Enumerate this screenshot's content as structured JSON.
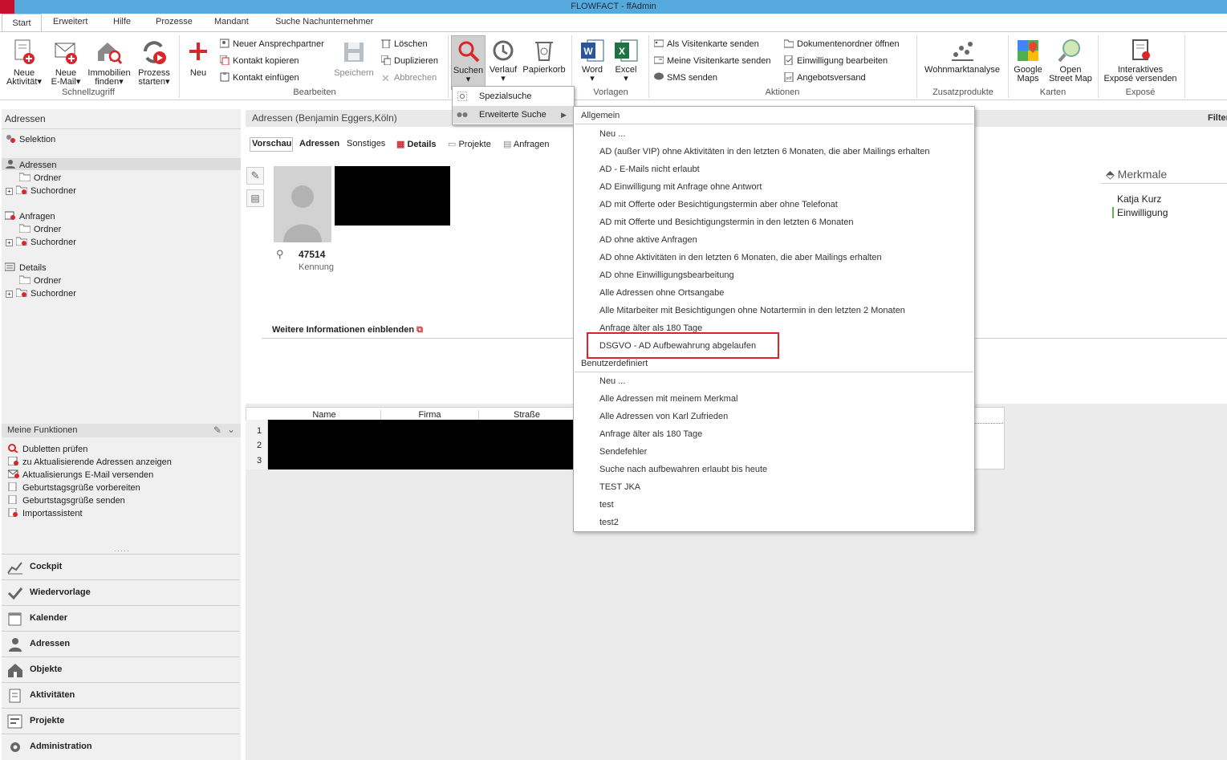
{
  "window": {
    "title": "FLOWFACT - ffAdmin"
  },
  "tabs": [
    "Start",
    "Erweitert",
    "Hilfe",
    "Prozesse",
    "Mandant",
    "Suche Nachunternehmer"
  ],
  "ribbon": {
    "schnellzugriff": {
      "group": "Schnellzugriff",
      "buttons": [
        "Neue Aktivität",
        "Neue E-Mail",
        "Immobilien finden",
        "Prozess starten"
      ],
      "lines": {
        "neue_aktivitaet": [
          "Neue",
          "Aktivität"
        ],
        "neue_email": [
          "Neue",
          "E-Mail"
        ],
        "immobilien": [
          "Immobilien",
          "finden"
        ],
        "prozess": [
          "Prozess",
          "starten"
        ]
      }
    },
    "bearbeiten": {
      "group": "Bearbeiten",
      "neu": "Neu",
      "neuer_ansprechpartner": "Neuer Ansprechpartner",
      "kontakt_kopieren": "Kontakt kopieren",
      "kontakt_einfuegen": "Kontakt einfügen",
      "speichern": "Speichern",
      "loeschen": "Löschen",
      "duplizieren": "Duplizieren",
      "abbrechen": "Abbrechen"
    },
    "suchen": {
      "suchen": "Suchen",
      "verlauf": "Verlauf",
      "papierkorb": "Papierkorb"
    },
    "vorlagen": {
      "group": "Vorlagen",
      "word": "Word",
      "excel": "Excel"
    },
    "aktionen": {
      "group": "Aktionen",
      "visitenkarte": "Als Visitenkarte senden",
      "meine_visitenkarte": "Meine Visitenkarte senden",
      "sms": "SMS senden",
      "dokumentenordner": "Dokumentenordner öffnen",
      "einwilligung": "Einwilligung bearbeiten",
      "angebotsversand": "Angebotsversand"
    },
    "zusatzprodukte": {
      "group": "Zusatzprodukte",
      "wohnmarktanalyse": "Wohnmarktanalyse"
    },
    "karten": {
      "group": "Karten",
      "google": [
        "Google",
        "Maps"
      ],
      "osm": [
        "Open",
        "Street Map"
      ]
    },
    "expose": {
      "group": "Exposé",
      "interaktiv": [
        "Interaktives",
        "Exposé versenden"
      ]
    }
  },
  "left_panel": {
    "title": "Adressen",
    "selektion": "Selektion",
    "sections": [
      {
        "label": "Adressen",
        "ordner": "Ordner",
        "suchordner": "Suchordner"
      },
      {
        "label": "Anfragen",
        "ordner": "Ordner",
        "suchordner": "Suchordner"
      },
      {
        "label": "Details",
        "ordner": "Ordner",
        "suchordner": "Suchordner"
      }
    ],
    "meine_funktionen": {
      "title": "Meine Funktionen",
      "items": [
        "Dubletten prüfen",
        "zu Aktualisierende Adressen anzeigen",
        "Aktualisierungs E-Mail versenden",
        "Geburtstagsgrüße vorbereiten",
        "Geburtstagsgrüße senden",
        "Importassistent"
      ]
    },
    "nav": [
      "Cockpit",
      "Wiedervorlage",
      "Kalender",
      "Adressen",
      "Objekte",
      "Aktivitäten",
      "Projekte",
      "Administration"
    ]
  },
  "main": {
    "header": "Adressen (Benjamin Eggers,Köln)",
    "filter": "Filter",
    "detail_tabs": [
      "Vorschau",
      "Adressen",
      "Sonstiges",
      "Details",
      "Projekte",
      "Anfragen"
    ],
    "kennung_value": "47514",
    "kennung_label": "Kennung",
    "weitere": "Weitere Informationen einblenden",
    "merkmale": {
      "title": "Merkmale",
      "items": [
        "Katja Kurz",
        "Einwilligung"
      ]
    },
    "table": {
      "columns": [
        "Name",
        "Firma",
        "Straße"
      ],
      "rows": [
        "1",
        "2",
        "3"
      ]
    }
  },
  "search_menu": {
    "items": [
      "Spezialsuche",
      "Erweiterte Suche"
    ]
  },
  "extended_search": {
    "allgemein_header": "Allgemein",
    "allgemein": [
      "Neu ...",
      "AD (außer VIP) ohne Aktivitäten in den letzten 6 Monaten, die aber Mailings erhalten",
      "AD - E-Mails nicht erlaubt",
      "AD Einwilligung mit Anfrage ohne Antwort",
      "AD mit Offerte oder Besichtigungstermin aber ohne Telefonat",
      "AD mit Offerte und Besichtigungstermin in den letzten 6 Monaten",
      "AD ohne aktive Anfragen",
      "AD ohne Aktivitäten in den letzten 6 Monaten, die aber Mailings erhalten",
      "AD ohne Einwilligungsbearbeitung",
      "Alle Adressen ohne Ortsangabe",
      "Alle Mitarbeiter mit Besichtigungen ohne Notartermin in den letzten 2 Monaten",
      "Anfrage älter als 180 Tage",
      "DSGVO - AD Aufbewahrung abgelaufen"
    ],
    "benutzer_header": "Benutzerdefiniert",
    "benutzer": [
      "Neu ...",
      "Alle Adressen mit meinem Merkmal",
      "Alle Adressen von Karl Zufrieden",
      "Anfrage älter als 180 Tage",
      "Sendefehler",
      "Suche nach aufbewahren erlaubt bis heute",
      "TEST JKA",
      "test",
      "test2"
    ],
    "highlight_color": "#e0202a"
  }
}
